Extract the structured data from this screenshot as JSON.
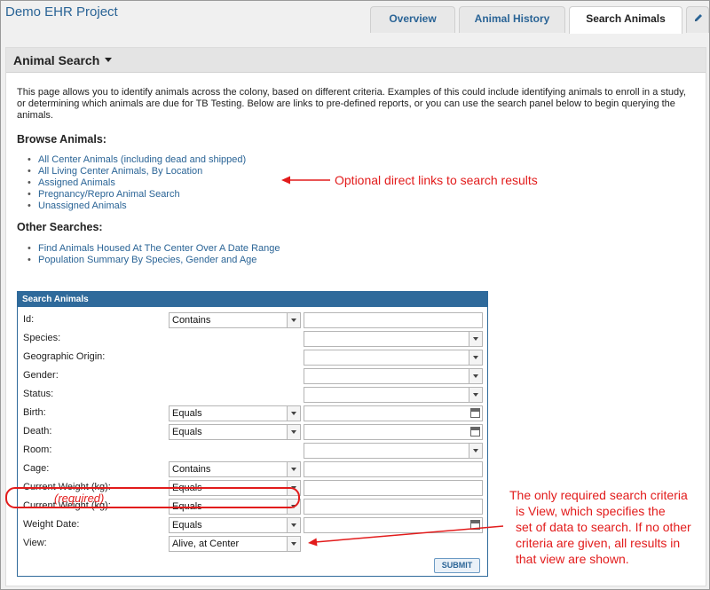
{
  "header": {
    "project_title": "Demo EHR Project",
    "tabs": [
      {
        "label": "Overview",
        "active": false
      },
      {
        "label": "Animal History",
        "active": false
      },
      {
        "label": "Search Animals",
        "active": true
      }
    ],
    "edit_icon": "pencil-icon"
  },
  "panel": {
    "title": "Animal Search",
    "intro": "This page allows you to identify animals across the colony, based on different criteria. Examples of this could include identifying animals to enroll in a study, or determining which animals are due for TB Testing. Below are links to pre-defined reports, or you can use the search panel below to begin querying the animals.",
    "browse_heading": "Browse Animals:",
    "browse_links": [
      "All Center Animals (including dead and shipped)",
      "All Living Center Animals, By Location",
      "Assigned Animals",
      "Pregnancy/Repro Animal Search",
      "Unassigned Animals"
    ],
    "other_heading": "Other Searches:",
    "other_links": [
      "Find Animals Housed At The Center Over A Date Range",
      "Population Summary By Species, Gender and Age"
    ]
  },
  "form": {
    "title": "Search Animals",
    "rows": [
      {
        "label": "Id:",
        "operator": "Contains",
        "value_type": "text"
      },
      {
        "label": "Species:",
        "operator": "",
        "value_type": "select"
      },
      {
        "label": "Geographic Origin:",
        "operator": "",
        "value_type": "select"
      },
      {
        "label": "Gender:",
        "operator": "",
        "value_type": "select"
      },
      {
        "label": "Status:",
        "operator": "",
        "value_type": "select"
      },
      {
        "label": "Birth:",
        "operator": "Equals",
        "value_type": "date"
      },
      {
        "label": "Death:",
        "operator": "Equals",
        "value_type": "date"
      },
      {
        "label": "Room:",
        "operator": "",
        "value_type": "select"
      },
      {
        "label": "Cage:",
        "operator": "Contains",
        "value_type": "text"
      },
      {
        "label": "Current Weight (kg):",
        "operator": "Equals",
        "value_type": "text"
      },
      {
        "label": "Current Weight (kg):",
        "operator": "Equals",
        "value_type": "text"
      },
      {
        "label": "Weight Date:",
        "operator": "Equals",
        "value_type": "date"
      },
      {
        "label": "View:",
        "operator": "Alive, at Center",
        "value_type": "none"
      }
    ],
    "required_note": "(required)",
    "submit_label": "SUBMIT"
  },
  "annotations": {
    "links_note": "Optional direct links to search results",
    "view_note_lines": [
      "The only required search criteria",
      "is View, which specifies the",
      "set of data to search. If no other",
      "criteria are given, all results in",
      "that view are shown."
    ],
    "color": "#e21b1b"
  }
}
